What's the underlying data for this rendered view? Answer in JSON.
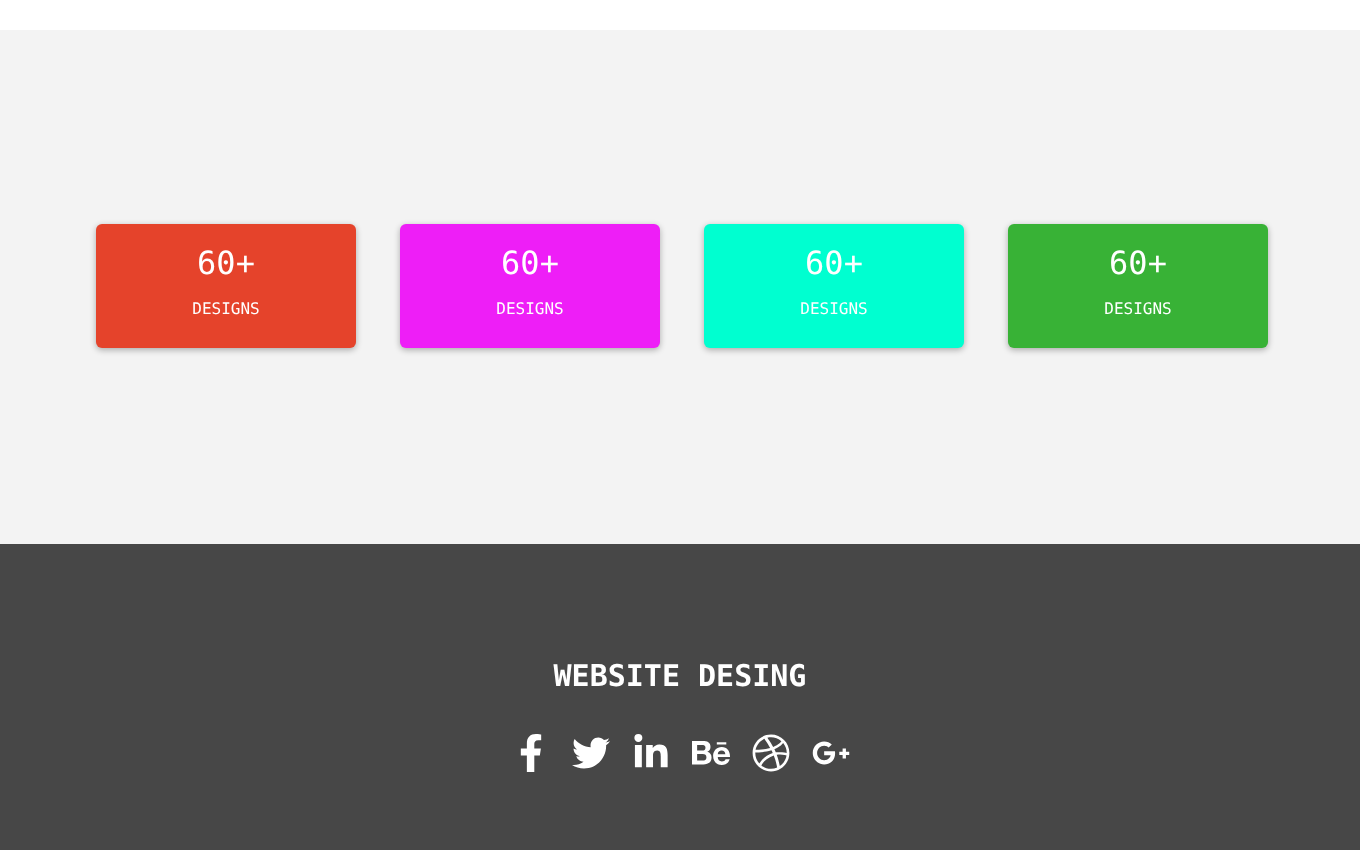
{
  "stats": [
    {
      "value": "60+",
      "label": "DESIGNS",
      "color": "#e5432b"
    },
    {
      "value": "60+",
      "label": "DESIGNS",
      "color": "#ee1ef7"
    },
    {
      "value": "60+",
      "label": "DESIGNS",
      "color": "#00ffd0"
    },
    {
      "value": "60+",
      "label": "DESIGNS",
      "color": "#38b236"
    }
  ],
  "footer": {
    "title": "WEBSITE DESING"
  }
}
